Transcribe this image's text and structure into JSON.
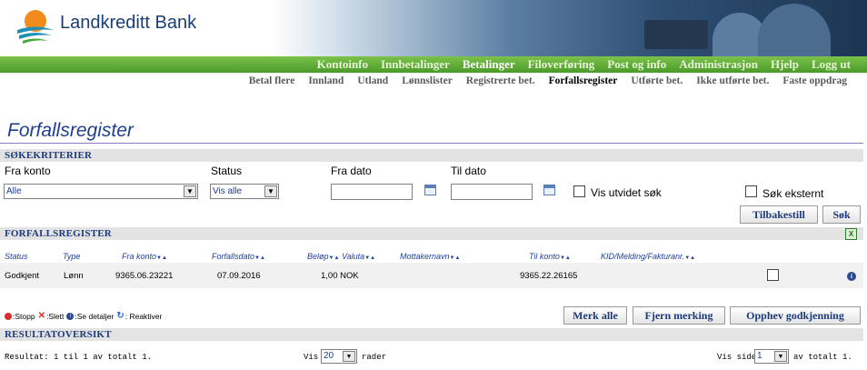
{
  "brand": {
    "name": "Landkreditt Bank"
  },
  "main_nav": [
    {
      "label": "Kontoinfo"
    },
    {
      "label": "Innbetalinger"
    },
    {
      "label": "Betalinger"
    },
    {
      "label": "Filoverføring"
    },
    {
      "label": "Post og info"
    },
    {
      "label": "Administrasjon"
    },
    {
      "label": "Hjelp"
    },
    {
      "label": "Logg ut"
    }
  ],
  "main_nav_active": "Betalinger",
  "sub_nav": [
    {
      "label": "Betal flere"
    },
    {
      "label": "Innland"
    },
    {
      "label": "Utland"
    },
    {
      "label": "Lønnslister"
    },
    {
      "label": "Registrerte bet."
    },
    {
      "label": "Forfallsregister"
    },
    {
      "label": "Utførte bet."
    },
    {
      "label": "Ikke utførte bet."
    },
    {
      "label": "Faste oppdrag"
    }
  ],
  "sub_nav_active": "Forfallsregister",
  "page_title": "Forfallsregister",
  "search": {
    "section_title": "SØKEKRITERIER",
    "fra_konto_label": "Fra konto",
    "fra_konto_value": "Alle",
    "status_label": "Status",
    "status_value": "Vis alle",
    "fra_dato_label": "Fra dato",
    "fra_dato_value": "",
    "til_dato_label": "Til dato",
    "til_dato_value": "",
    "vis_utvidet_label": "Vis utvidet søk",
    "sok_eksternt_label": "Søk eksternt",
    "reset_button": "Tilbakestill",
    "search_button": "Søk"
  },
  "register": {
    "section_title": "FORFALLSREGISTER",
    "columns": [
      "Status",
      "Type",
      "Fra konto",
      "Forfallsdato",
      "Beløp",
      "Valuta",
      "Mottakernavn",
      "Til konto",
      "KID/Melding/Fakturanr."
    ],
    "rows": [
      {
        "status": "Godkjent",
        "type": "Lønn",
        "fra_konto": "9365.06.23221",
        "forfallsdato": "07.09.2016",
        "belop_valuta": "1,00 NOK",
        "mottakernavn": "",
        "til_konto": "9365.22.26165",
        "kid": ""
      }
    ]
  },
  "legend": {
    "stopp": ":Stopp",
    "slett": ":Slett",
    "detaljer": ":Se detaljer",
    "reaktiver": ": Reaktiver"
  },
  "actions": {
    "merk_alle": "Merk alle",
    "fjern_merking": "Fjern merking",
    "opphev": "Opphev godkjenning"
  },
  "overview": {
    "section_title": "RESULTATOVERSIKT",
    "result_text": "Resultat: 1 til 1 av totalt 1.",
    "vis_label": "Vis",
    "vis_value": "20",
    "rader_label": "rader",
    "vis_side_label": "Vis side",
    "vis_side_value": "1",
    "av_totalt": "av totalt 1."
  },
  "colors": {
    "nav_green": "#5aa832",
    "title_blue": "#1f3f8f",
    "section_bg": "#e3e3e3"
  }
}
